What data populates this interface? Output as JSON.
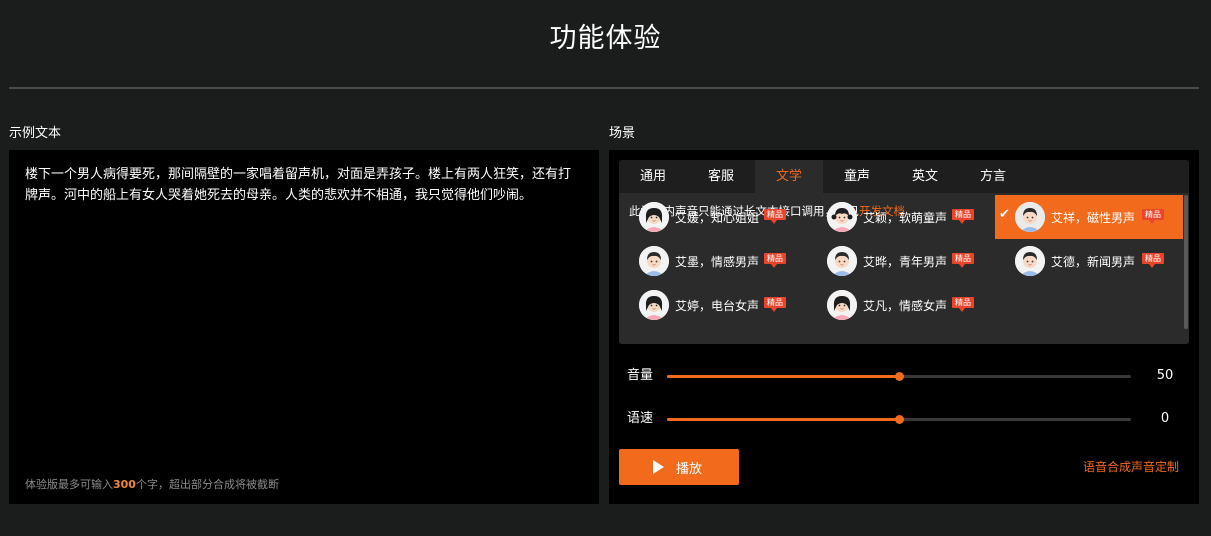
{
  "page": {
    "title": "功能体验"
  },
  "sample": {
    "label": "示例文本",
    "text": "楼下一个男人病得要死，那间隔壁的一家唱着留声机，对面是弄孩子。楼上有两人狂笑，还有打牌声。河中的船上有女人哭着她死去的母亲。人类的悲欢并不相通，我只觉得他们吵闹。",
    "limit_prefix": "体验版最多可输入",
    "limit_count": "300",
    "limit_suffix": "个字，超出部分合成将被截断"
  },
  "scene": {
    "label": "场景",
    "tabs": [
      {
        "label": "通用",
        "active": false
      },
      {
        "label": "客服",
        "active": false
      },
      {
        "label": "文学",
        "active": true
      },
      {
        "label": "童声",
        "active": false
      },
      {
        "label": "英文",
        "active": false
      },
      {
        "label": "方言",
        "active": false
      }
    ],
    "note_text": "此场景内声音只能通过长文本接口调用，详见",
    "note_link": "开发文档",
    "badge_label": "精品",
    "check_icon": "check-icon",
    "voices": [
      {
        "name": "艾媛，知心姐姐",
        "gender": "female",
        "active": false
      },
      {
        "name": "艾颖，软萌童声",
        "gender": "child",
        "active": false
      },
      {
        "name": "艾祥，磁性男声",
        "gender": "male",
        "active": true
      },
      {
        "name": "艾墨，情感男声",
        "gender": "male",
        "active": false
      },
      {
        "name": "艾晔，青年男声",
        "gender": "male",
        "active": false
      },
      {
        "name": "艾德，新闻男声",
        "gender": "male",
        "active": false
      },
      {
        "name": "艾婷，电台女声",
        "gender": "female",
        "active": false
      },
      {
        "name": "艾凡，情感女声",
        "gender": "female",
        "active": false
      }
    ]
  },
  "controls": {
    "volume": {
      "label": "音量",
      "value": 50,
      "display": "50",
      "fraction": 0.5
    },
    "speed": {
      "label": "语速",
      "value": 0,
      "display": "0",
      "fraction": 0.5
    },
    "play_label": "播放",
    "custom_link": "语音合成声音定制"
  },
  "colors": {
    "accent": "#f26a1b",
    "badge": "#e9452b",
    "background": "#1b1c1c"
  }
}
